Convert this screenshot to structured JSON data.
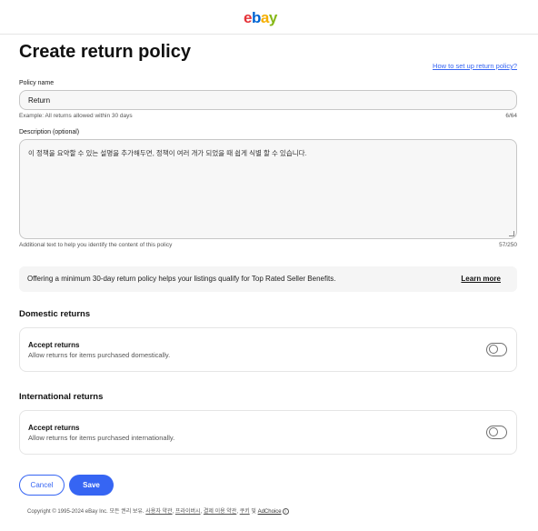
{
  "header": {
    "logo": {
      "e": "e",
      "b": "b",
      "a": "a",
      "y": "y"
    }
  },
  "page": {
    "title": "Create return policy",
    "help_link": "How to set up return policy?"
  },
  "policy_name": {
    "label": "Policy name",
    "value": "Return",
    "helper": "Example: All returns allowed within 30 days",
    "counter": "6/64"
  },
  "description": {
    "label": "Description (optional)",
    "value": "이 정책을 요약할 수 있는 설명을 추가해두면, 정책이 여러 개가 되었을 때 쉽게 식별 할 수 있습니다.",
    "helper": "Additional text to help you identify the content of this policy",
    "counter": "57/250"
  },
  "info_banner": {
    "text": "Offering a minimum 30-day return policy helps your listings qualify for Top Rated Seller Benefits.",
    "link": "Learn more"
  },
  "domestic": {
    "section_title": "Domestic returns",
    "card_title": "Accept returns",
    "card_desc": "Allow returns for items purchased domestically.",
    "enabled": false
  },
  "international": {
    "section_title": "International returns",
    "card_title": "Accept returns",
    "card_desc": "Allow returns for items purchased internationally.",
    "enabled": false
  },
  "actions": {
    "cancel": "Cancel",
    "save": "Save"
  },
  "footer": {
    "copyright": "Copyright © 1995-2024 eBay Inc. 모든 권리 보유.",
    "links": [
      "사용자 약관",
      "프라이버시",
      "결제 이용 약관",
      "쿠키"
    ],
    "and": "및",
    "adchoice": "AdChoice",
    "adchoice_icon": "i"
  },
  "colors": {
    "accent": "#3665f3",
    "logo_e": "#e53238",
    "logo_b": "#0064d2",
    "logo_a": "#f5af02",
    "logo_y": "#86b817"
  }
}
